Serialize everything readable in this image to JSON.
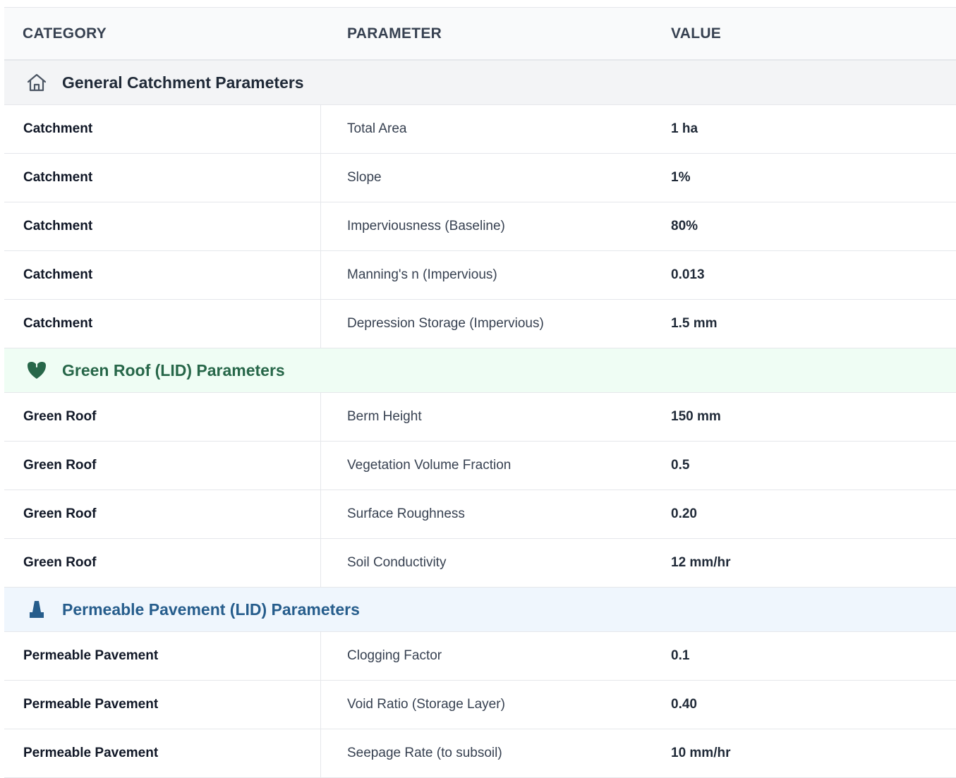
{
  "header": {
    "category": "CATEGORY",
    "parameter": "PARAMETER",
    "value": "VALUE"
  },
  "sections": [
    {
      "title": "General Catchment Parameters",
      "icon": "home-icon",
      "color": "#1f2937",
      "rows": [
        {
          "category": "Catchment",
          "parameter": "Total Area",
          "value": "1 ha"
        },
        {
          "category": "Catchment",
          "parameter": "Slope",
          "value": "1%"
        },
        {
          "category": "Catchment",
          "parameter": "Imperviousness (Baseline)",
          "value": "80%"
        },
        {
          "category": "Catchment",
          "parameter": "Manning's n (Impervious)",
          "value": "0.013"
        },
        {
          "category": "Catchment",
          "parameter": "Depression Storage (Impervious)",
          "value": "1.5 mm"
        }
      ]
    },
    {
      "title": "Green Roof (LID) Parameters",
      "icon": "leaf-icon",
      "color": "#276749",
      "rows": [
        {
          "category": "Green Roof",
          "parameter": "Berm Height",
          "value": "150 mm"
        },
        {
          "category": "Green Roof",
          "parameter": "Vegetation Volume Fraction",
          "value": "0.5"
        },
        {
          "category": "Green Roof",
          "parameter": "Surface Roughness",
          "value": "0.20"
        },
        {
          "category": "Green Roof",
          "parameter": "Soil Conductivity",
          "value": "12 mm/hr"
        }
      ]
    },
    {
      "title": "Permeable Pavement (LID) Parameters",
      "icon": "road-icon",
      "color": "#265d8c",
      "rows": [
        {
          "category": "Permeable Pavement",
          "parameter": "Clogging Factor",
          "value": "0.1"
        },
        {
          "category": "Permeable Pavement",
          "parameter": "Void Ratio (Storage Layer)",
          "value": "0.40"
        },
        {
          "category": "Permeable Pavement",
          "parameter": "Seepage Rate (to subsoil)",
          "value": "10 mm/hr"
        }
      ]
    }
  ]
}
